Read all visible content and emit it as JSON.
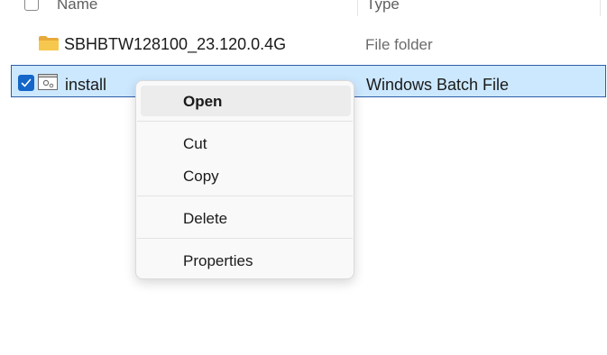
{
  "header": {
    "name_label": "Name",
    "type_label": "Type"
  },
  "files": [
    {
      "name": "SBHBTW128100_23.120.0.4G",
      "type": "File folder",
      "icon": "folder-icon"
    },
    {
      "name": "install",
      "type": "Windows Batch File",
      "icon": "batch-file-icon",
      "selected": true
    }
  ],
  "context_menu": {
    "items": [
      {
        "label": "Open",
        "bold": true
      },
      {
        "label": "Cut"
      },
      {
        "label": "Copy"
      },
      {
        "label": "Delete"
      },
      {
        "label": "Properties"
      }
    ]
  },
  "colors": {
    "selection_bg": "#cce8ff",
    "selection_border": "#2b5ea8",
    "checkbox_accent": "#1466c9",
    "folder": "#f4c04e"
  }
}
